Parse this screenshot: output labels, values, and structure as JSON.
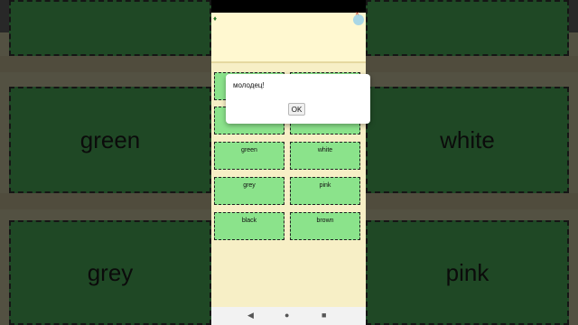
{
  "background": {
    "cards": [
      "green",
      "white",
      "grey",
      "pink"
    ]
  },
  "app": {
    "cards": [
      {
        "label": ""
      },
      {
        "label": ""
      },
      {
        "label": ""
      },
      {
        "label": ""
      },
      {
        "label": "green"
      },
      {
        "label": "white"
      },
      {
        "label": "grey"
      },
      {
        "label": "pink"
      },
      {
        "label": "black"
      },
      {
        "label": "brown"
      }
    ]
  },
  "dialog": {
    "message": "молодец!",
    "ok_label": "OK"
  },
  "navbar": {
    "back_icon": "◀",
    "home_icon": "●",
    "recents_icon": "■"
  },
  "colors": {
    "card": "#8be38b",
    "card_dark": "#2f6b37",
    "page_bg": "#f7efc6"
  },
  "icons": {
    "left_titlebar": "android-icon",
    "right_titlebar": "globe-icon"
  }
}
